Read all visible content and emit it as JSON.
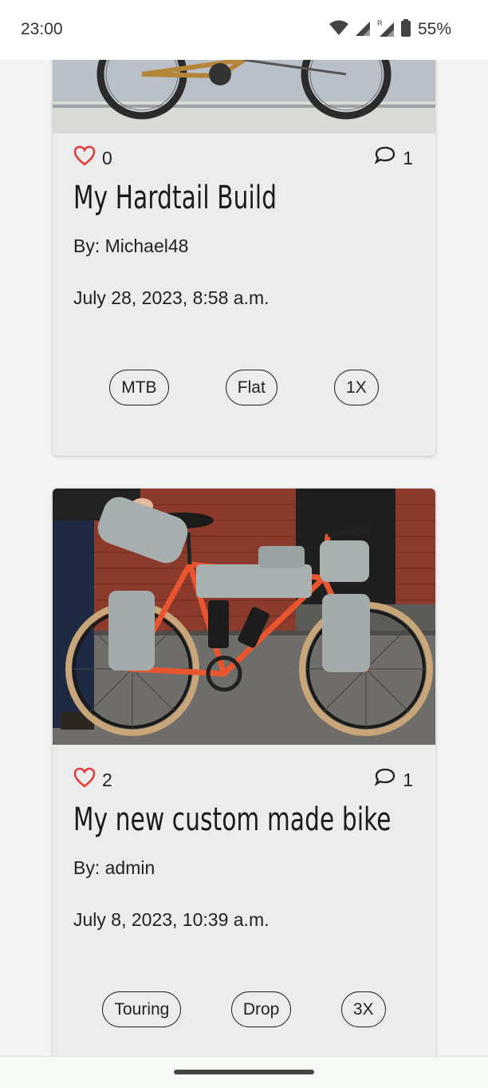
{
  "status_bar": {
    "time": "23:00",
    "battery": "55%",
    "icons": [
      "wifi-icon",
      "signal-icon",
      "roaming-signal-icon",
      "battery-icon"
    ]
  },
  "posts": [
    {
      "likes": "0",
      "comments": "1",
      "title": "My Hardtail Build",
      "author": "By: Michael48",
      "date": "July 28, 2023, 8:58 a.m.",
      "tags": [
        "MTB",
        "Flat",
        "1X"
      ]
    },
    {
      "likes": "2",
      "comments": "1",
      "title": "My new custom made bike",
      "author": "By: admin",
      "date": "July 8, 2023, 10:39 a.m.",
      "tags": [
        "Touring",
        "Drop",
        "3X"
      ]
    }
  ],
  "colors": {
    "like": "#e53935",
    "card_bg": "#ececec",
    "page_bg": "#f3f3f3",
    "frame_orange": "#e8552e"
  }
}
